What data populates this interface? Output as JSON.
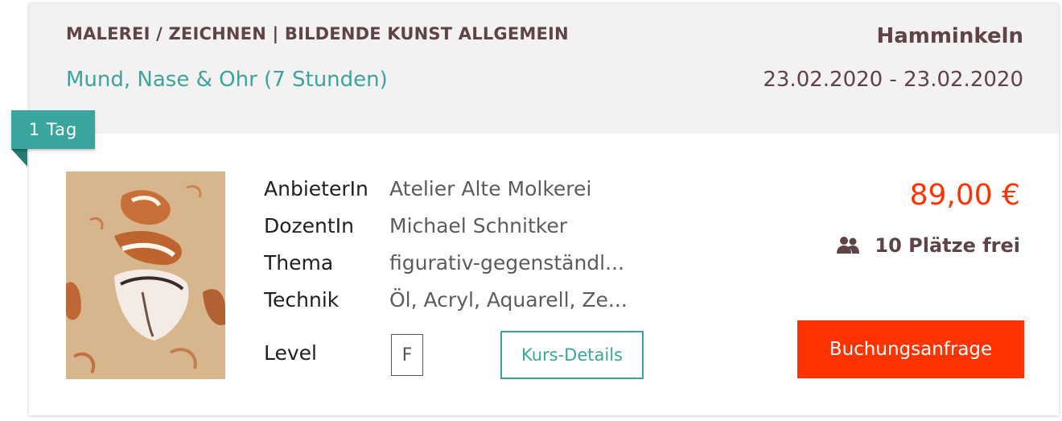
{
  "header": {
    "category": "MALEREI / ZEICHNEN | BILDENDE KUNST ALLGEMEIN",
    "course_title": "Mund, Nase & Ohr (7 Stunden)",
    "location": "Hamminkeln",
    "dates": "23.02.2020 - 23.02.2020"
  },
  "duration_badge": "1 Tag",
  "details": [
    {
      "label": "AnbieterIn",
      "value": "Atelier Alte Molkerei"
    },
    {
      "label": "DozentIn",
      "value": "Michael Schnitker"
    },
    {
      "label": "Thema",
      "value": "figurativ-gegenständl..."
    },
    {
      "label": "Technik",
      "value": "Öl, Acryl, Aquarell, Ze..."
    }
  ],
  "level": {
    "label": "Level",
    "value": "F"
  },
  "details_button": "Kurs-Details",
  "price": "89,00 €",
  "seats": {
    "icon": "people-icon",
    "text": "10 Plätze frei"
  },
  "booking_button": "Buchungsanfrage",
  "colors": {
    "accent_teal": "#3aa59c",
    "price_red": "#ff3300",
    "header_bg": "#f3f1f1",
    "heading_brown": "#5e4347"
  }
}
